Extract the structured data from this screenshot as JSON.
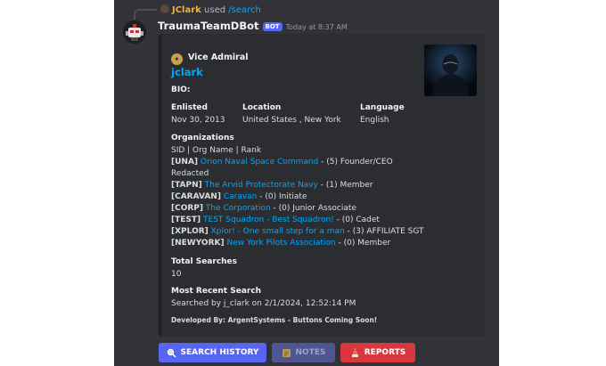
{
  "reply": {
    "user": "JClark",
    "used_text": "used",
    "command": "/search"
  },
  "message": {
    "bot_name": "TraumaTeamDBot",
    "bot_tag": "BOT",
    "timestamp": "Today at 8:37 AM"
  },
  "embed": {
    "author": "Vice Admiral",
    "title": "jclark",
    "bio_label": "BIO:",
    "fields": {
      "enlisted_label": "Enlisted",
      "enlisted_value": "Nov 30, 2013",
      "location_label": "Location",
      "location_value": "United States , New York",
      "language_label": "Language",
      "language_value": "English"
    },
    "organizations_label": "Organizations",
    "organizations_header": "SID | Org Name | Rank",
    "organizations": [
      {
        "sid": "[UNA]",
        "name": "Orion Naval Space Command",
        "rank": " - (5) Founder/CEO"
      },
      {
        "sid": "",
        "name": "",
        "rank": "Redacted"
      },
      {
        "sid": "[TAPN]",
        "name": "The Arvid Protectorate Navy",
        "rank": " - (1) Member"
      },
      {
        "sid": "[CARAVAN]",
        "name": "Caravan",
        "rank": " - (0) Initiate"
      },
      {
        "sid": "[CORP]",
        "name": "The Corporation",
        "rank": " - (0) Junior Associate"
      },
      {
        "sid": "[TEST]",
        "name": "TEST Squadron - Best Squadron!",
        "rank": " - (0) Cadet"
      },
      {
        "sid": "[XPLOR]",
        "name": "Xplor! - One small step for a man",
        "rank": " - (3) AFFILIATE SGT"
      },
      {
        "sid": "[NEWYORK]",
        "name": "New York Pilots Association",
        "rank": " - (0) Member"
      }
    ],
    "total_searches_label": "Total Searches",
    "total_searches_value": "10",
    "recent_search_label": "Most Recent Search",
    "recent_search_value": "Searched by j_clark on 2/1/2024, 12:52:14 PM",
    "footer": "Developed By: ArgentSystems - Buttons Coming Soon!"
  },
  "buttons": {
    "search_history": "SEARCH HISTORY",
    "notes": "NOTES",
    "reports": "REPORTS"
  },
  "colors": {
    "background": "#313338",
    "embed": "#2b2d31",
    "link": "#00a8fc",
    "blurple": "#5865f2",
    "danger": "#da373c",
    "reply_user": "#f0b232"
  },
  "icons": {
    "author": "insignia-icon",
    "search_history": "magnifier-icon",
    "notes": "notepad-icon",
    "reports": "alert-icon"
  }
}
